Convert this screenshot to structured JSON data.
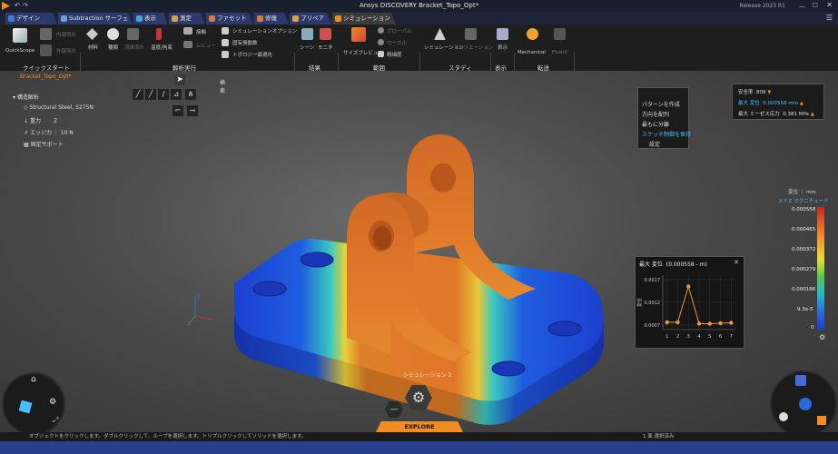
{
  "window": {
    "title": "Ansys DISCOVERY   Bracket_Topo_Opt*",
    "release": "Release 2023 R1"
  },
  "tabs": [
    {
      "label": "デザイン",
      "color": "#3d7bd4"
    },
    {
      "label": "Subtraction サーフェス",
      "color": "#6aa0e0"
    },
    {
      "label": "表示",
      "color": "#4aa3d8"
    },
    {
      "label": "測定",
      "color": "#d8a040"
    },
    {
      "label": "ファセット",
      "color": "#e07a3a"
    },
    {
      "label": "修復",
      "color": "#e07a3a"
    },
    {
      "label": "プリペア",
      "color": "#e0a040"
    },
    {
      "label": "シミュレーション",
      "color": "#f08c20"
    }
  ],
  "ribbon": {
    "quickstart_label": "QuickScope",
    "quickstart_group": "クイックスタート",
    "analysis_group": "解析実行",
    "results_group": "結果",
    "scope_group": "範囲",
    "study_group": "スタディ",
    "display_group": "表示",
    "transfer_group": "転送",
    "items": {
      "material": "材料",
      "load": "種類",
      "flow": "流体流れ",
      "heat": "熱流",
      "temperature": "温度/拘束",
      "contact": "接触",
      "connector": "レビュー",
      "sim_options": "シミュレーションオプション",
      "inherent": "固有振動数",
      "topo": "トポロジー最適化",
      "scene": "シーン",
      "monitor": "モニタ",
      "size_preview": "サイズプレビュー",
      "global": "グローバル",
      "local": "ローカル",
      "refine": "精細度",
      "simulation": "シミュレーション",
      "variation": "バリエーション",
      "show": "表示",
      "mechanical": "Mechanical",
      "fluent": "Fluent",
      "refined_out": "内部流れ",
      "refined_out2": "外部流れ"
    }
  },
  "tree": {
    "tab": "Bracket_Topo_Opt*",
    "items": [
      "構造解析",
      "Structural Steel, S275N",
      "重力",
      "エッジ力 ｜ 10 N",
      "固定サポート"
    ],
    "gravity_axis": "Z"
  },
  "toolbar": {
    "select_label": "検索"
  },
  "context_menu": {
    "items": [
      "パターンを作成",
      "方向を配列",
      "最もに分離",
      "スケッチ制御を保持"
    ],
    "footer": "設定"
  },
  "results_legend": {
    "items": [
      {
        "label": "安全率",
        "value": "808"
      },
      {
        "label": "最大 変位",
        "value": "0.000558 mm"
      },
      {
        "label": "最大 ミーゼス応力",
        "value": "0.381 MPa"
      }
    ],
    "header": "変位 ｜ mm",
    "axes_label": "X  Y  Z  マグニチュード",
    "scale_values": [
      "0.000558",
      "0.000465",
      "0.000372",
      "0.000279",
      "0.000186",
      "9.3e-5",
      "0"
    ]
  },
  "chart_data": {
    "type": "line",
    "title": "最大 変位",
    "subtitle": "(0.000558 - m)",
    "x": [
      1,
      2,
      3,
      4,
      5,
      6,
      7
    ],
    "values": [
      0.00076,
      0.00076,
      0.00155,
      0.00073,
      0.00073,
      0.00074,
      0.00075
    ],
    "xticks": [
      "1",
      "2",
      "3",
      "4",
      "5",
      "6",
      "7"
    ],
    "ytick_labels": [
      "0.0017",
      "0.0012",
      "0.0007"
    ],
    "ytick_values": [
      0.0017,
      0.0012,
      0.0007
    ],
    "ylabel": "変位",
    "ylim": [
      0.0006,
      0.0018
    ],
    "grid": true,
    "line_color": "#e8973a"
  },
  "viewport": {
    "sim_label": "シミュレーション 2",
    "explore_label": "EXPLORE",
    "axis_labels": {
      "x": "X",
      "y": "Y",
      "z": "Z"
    }
  },
  "statusbar": {
    "hint": "オブジェクトをクリックします。ダブルクリックして、ループを選択します。トリプルクリックしてソリッドを選択します。",
    "right": "1 面 選択済み"
  },
  "colors": {
    "accent": "#f08c20",
    "ribbon_bg": "#1e1e1e",
    "bottom_bar": "#27408b"
  }
}
